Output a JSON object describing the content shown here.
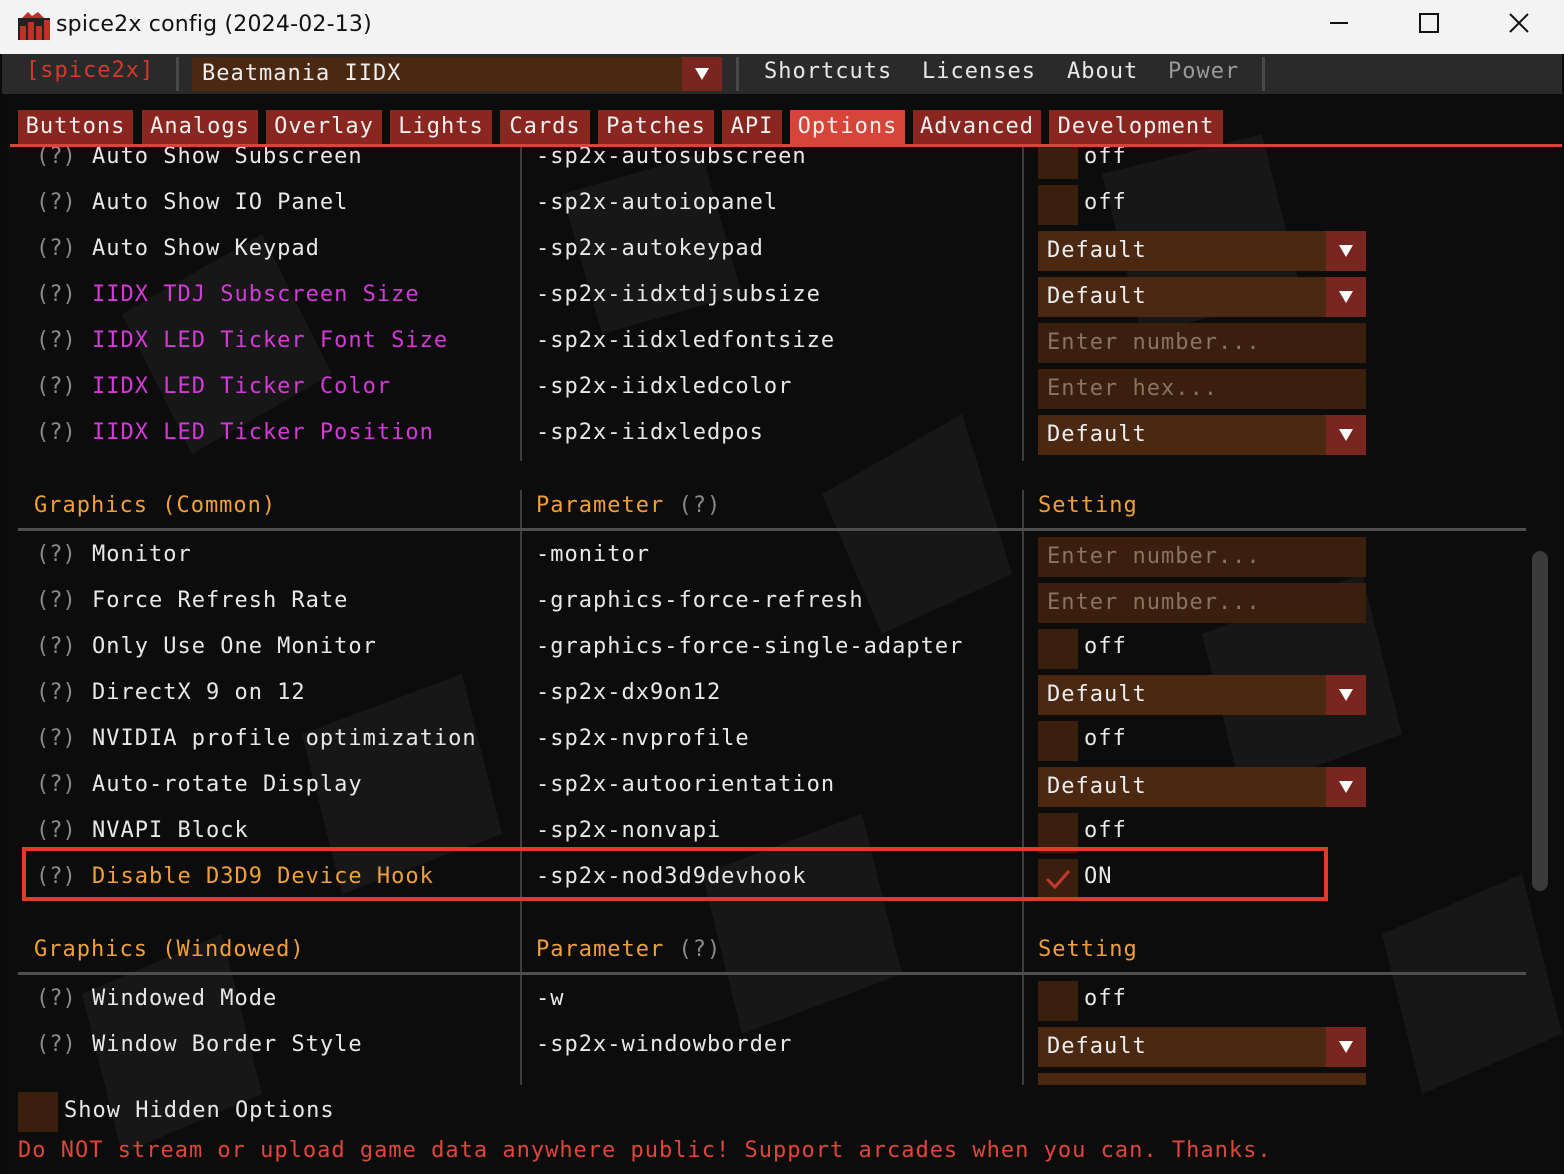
{
  "window": {
    "title": "spice2x config (2024-02-13)"
  },
  "menubar": {
    "brand": "[spice2x]",
    "game_selected": "Beatmania IIDX",
    "items": [
      "Shortcuts",
      "Licenses",
      "About",
      "Power"
    ]
  },
  "tabs": [
    {
      "label": "Buttons",
      "active": false
    },
    {
      "label": "Analogs",
      "active": false
    },
    {
      "label": "Overlay",
      "active": false
    },
    {
      "label": "Lights",
      "active": false
    },
    {
      "label": "Cards",
      "active": false
    },
    {
      "label": "Patches",
      "active": false
    },
    {
      "label": "API",
      "active": false
    },
    {
      "label": "Options",
      "active": true
    },
    {
      "label": "Advanced",
      "active": false
    },
    {
      "label": "Development",
      "active": false
    }
  ],
  "help_marker": "(?)",
  "sections": {
    "top": {
      "rows": [
        {
          "label": "Auto Show Subscreen",
          "param": "-sp2x-autosubscreen",
          "control": "checkbox",
          "value": "off"
        },
        {
          "label": "Auto Show IO Panel",
          "param": "-sp2x-autoiopanel",
          "control": "checkbox",
          "value": "off"
        },
        {
          "label": "Auto Show Keypad",
          "param": "-sp2x-autokeypad",
          "control": "select",
          "value": "Default"
        },
        {
          "label": "IIDX TDJ Subscreen Size",
          "param": "-sp2x-iidxtdjsubsize",
          "control": "select",
          "value": "Default",
          "color": "magenta"
        },
        {
          "label": "IIDX LED Ticker Font Size",
          "param": "-sp2x-iidxledfontsize",
          "control": "input",
          "placeholder": "Enter number...",
          "color": "magenta"
        },
        {
          "label": "IIDX LED Ticker Color",
          "param": "-sp2x-iidxledcolor",
          "control": "input",
          "placeholder": "Enter hex...",
          "color": "magenta"
        },
        {
          "label": "IIDX LED Ticker Position",
          "param": "-sp2x-iidxledpos",
          "control": "select",
          "value": "Default",
          "color": "magenta"
        }
      ]
    },
    "graphics_common": {
      "title": "Graphics (Common)",
      "param_header": "Parameter",
      "param_help": "(?)",
      "setting_header": "Setting",
      "rows": [
        {
          "label": "Monitor",
          "param": "-monitor",
          "control": "input",
          "placeholder": "Enter number..."
        },
        {
          "label": "Force Refresh Rate",
          "param": "-graphics-force-refresh",
          "control": "input",
          "placeholder": "Enter number..."
        },
        {
          "label": "Only Use One Monitor",
          "param": "-graphics-force-single-adapter",
          "control": "checkbox",
          "value": "off"
        },
        {
          "label": "DirectX 9 on 12",
          "param": "-sp2x-dx9on12",
          "control": "select",
          "value": "Default"
        },
        {
          "label": "NVIDIA profile optimization",
          "param": "-sp2x-nvprofile",
          "control": "checkbox",
          "value": "off"
        },
        {
          "label": "Auto-rotate Display",
          "param": "-sp2x-autoorientation",
          "control": "select",
          "value": "Default"
        },
        {
          "label": "NVAPI Block",
          "param": "-sp2x-nonvapi",
          "control": "checkbox",
          "value": "off"
        },
        {
          "label": "Disable D3D9 Device Hook",
          "param": "-sp2x-nod3d9devhook",
          "control": "checkbox",
          "value": "ON",
          "checked": true,
          "color": "orange"
        }
      ]
    },
    "graphics_windowed": {
      "title": "Graphics (Windowed)",
      "param_header": "Parameter",
      "param_help": "(?)",
      "setting_header": "Setting",
      "rows": [
        {
          "label": "Windowed Mode",
          "param": "-w",
          "control": "checkbox",
          "value": "off"
        },
        {
          "label": "Window Border Style",
          "param": "-sp2x-windowborder",
          "control": "select",
          "value": "Default"
        }
      ]
    }
  },
  "footer": {
    "show_hidden_label": "Show Hidden Options",
    "warning": "Do NOT stream or upload game data anywhere public! Support arcades when you can. Thanks."
  },
  "colors": {
    "accent": "#d6453a",
    "tab": "#8a2620",
    "section_header": "#f0a038",
    "dev_label": "#d43ad8",
    "control_bg": "#4a2812",
    "highlight_box": "#e23a26"
  }
}
